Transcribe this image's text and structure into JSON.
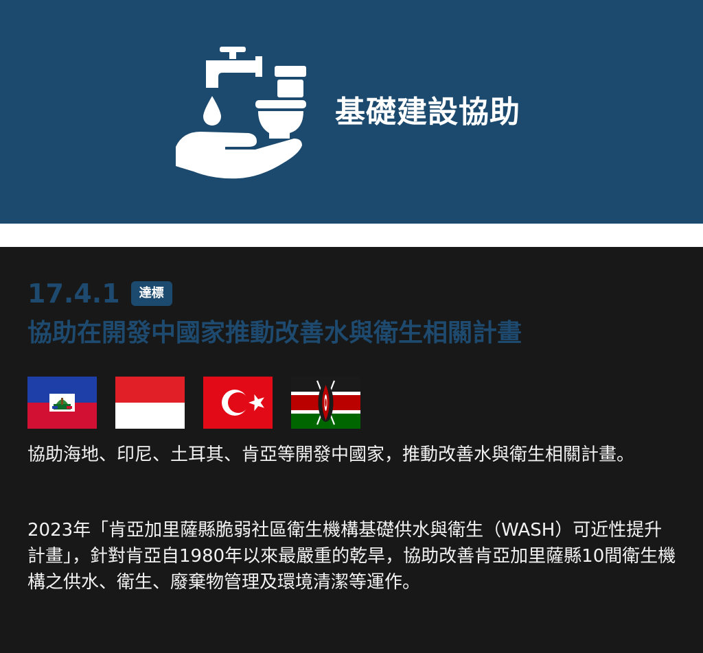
{
  "header": {
    "title": "基礎建設協助",
    "icon": "water-sanitation-icon",
    "background_color": "#1c4a6e"
  },
  "target": {
    "code": "17.4.1",
    "badge": "達標",
    "title": "協助在開發中國家推動改善水與衛生相關計畫",
    "accent_color": "#1d4a6e"
  },
  "flags": [
    {
      "country": "haiti",
      "icon": "haiti-flag-icon"
    },
    {
      "country": "indonesia",
      "icon": "indonesia-flag-icon"
    },
    {
      "country": "turkey",
      "icon": "turkey-flag-icon"
    },
    {
      "country": "kenya",
      "icon": "kenya-flag-icon"
    }
  ],
  "paragraphs": [
    "協助海地、印尼、土耳其、肯亞等開發中國家，推動改善水與衛生相關計畫。",
    "2023年「肯亞加里薩縣脆弱社區衛生機構基礎供水與衛生（WASH）可近性提升計畫」，針對肯亞自1980年以來最嚴重的乾旱，協助改善肯亞加里薩縣10間衛生機構之供水、衛生、廢棄物管理及環境清潔等運作。"
  ]
}
